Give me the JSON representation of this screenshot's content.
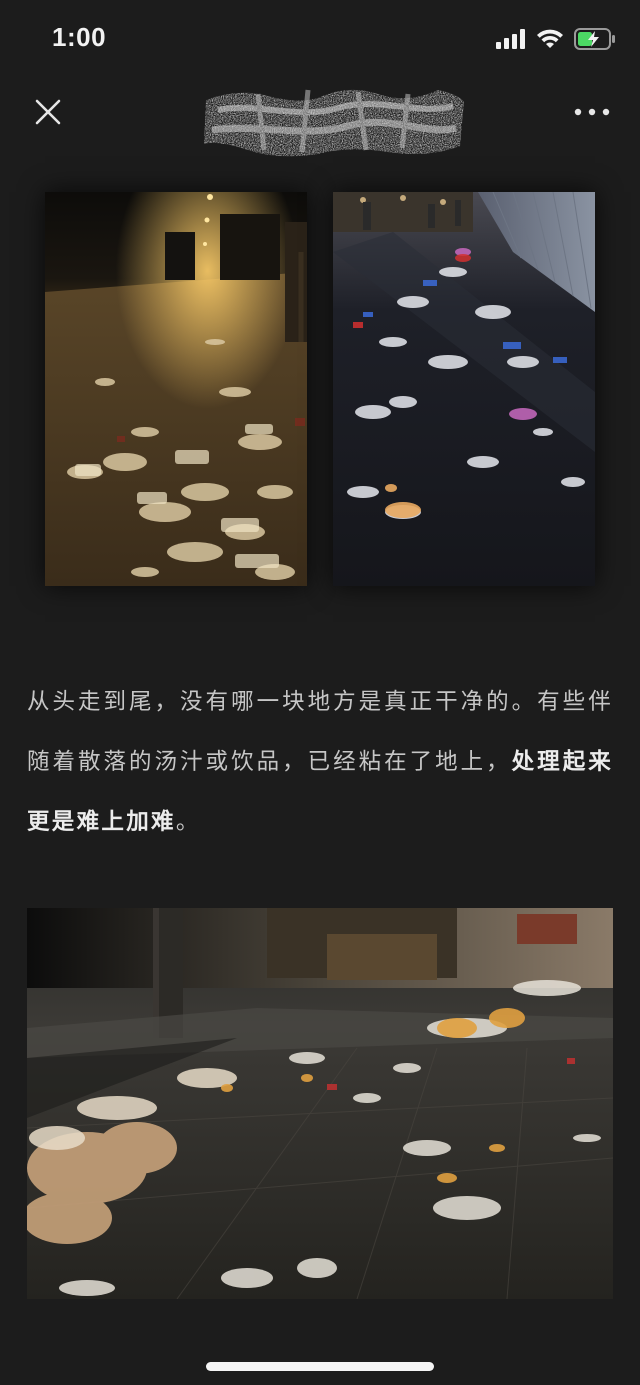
{
  "status_bar": {
    "time": "1:00",
    "icons": [
      "cellular-signal-icon",
      "wifi-icon",
      "battery-charging-icon"
    ],
    "battery_color": "#4cd964"
  },
  "nav": {
    "title": "",
    "close_icon": "close-icon",
    "more_icon": "more-dots-icon"
  },
  "article": {
    "paragraph_part1": "从头走到尾，没有哪一块地方是真正干净的。有些伴随着散落的汤汁或饮品，已经粘在了地上，",
    "paragraph_bold": "处理起来更是难上加难",
    "paragraph_end": "。"
  },
  "images": [
    {
      "name": "night-street-litter-warm-photo",
      "tone": "#a07840"
    },
    {
      "name": "night-market-litter-wet-street-photo",
      "tone": "#2a2d36"
    },
    {
      "name": "sidewalk-litter-wide-photo",
      "tone": "#3a3632"
    }
  ],
  "colors": {
    "background": "#1c1c1c",
    "text": "#c6c6c6",
    "bold_text": "#ececec"
  }
}
